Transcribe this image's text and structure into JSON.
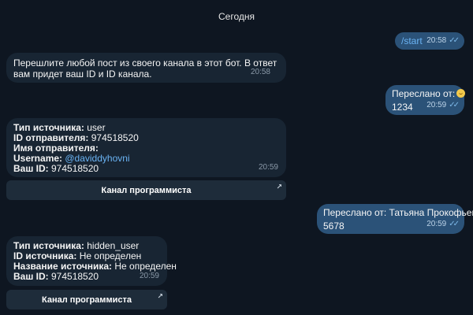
{
  "date_separator": "Сегодня",
  "messages": [
    {
      "text": "/start",
      "time": "20:58"
    },
    {
      "text": "Перешлите любой пост из своего канала в этот бот. В ответ вам придет ваш ID и ID канала.",
      "time": "20:58"
    },
    {
      "forwarded_label": "Переслано от:",
      "text": "1234",
      "time": "20:59"
    },
    {
      "lines": [
        {
          "label": "Тип источника:",
          "value": " user"
        },
        {
          "label": "ID отправителя:",
          "value": " 974518520"
        },
        {
          "label": "Имя отправителя:",
          "value": ""
        },
        {
          "label": "Username:",
          "value": " @daviddyhovni"
        },
        {
          "label": "Ваш ID:",
          "value": " 974518520"
        }
      ],
      "time": "20:59",
      "button": "Канал программиста"
    },
    {
      "forwarded_label": "Переслано от: Татьяна Прокофьева",
      "text": "5678",
      "time": "20:59"
    },
    {
      "lines": [
        {
          "label": "Тип источника:",
          "value": " hidden_user"
        },
        {
          "label": "ID источника:",
          "value": " Не определен"
        },
        {
          "label": "Название источника:",
          "value": " Не определен"
        },
        {
          "label": "Ваш ID:",
          "value": " 974518520"
        }
      ],
      "time": "20:59",
      "button": "Канал программиста"
    }
  ],
  "read_checks": "✓✓",
  "button_arrow": "↗",
  "colors": {
    "background": "#0e1621",
    "incoming_bubble": "#182533",
    "outgoing_bubble": "#2b5278",
    "link": "#6ab3f3"
  }
}
